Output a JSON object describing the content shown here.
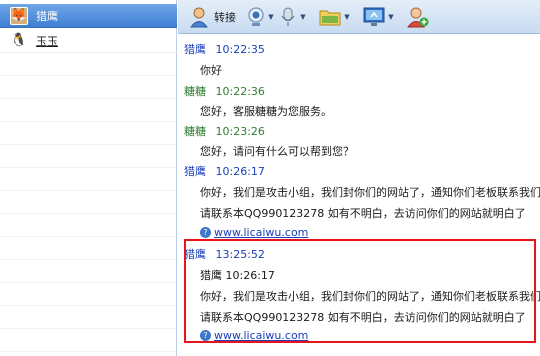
{
  "contacts": [
    {
      "name": "猎鹰",
      "selected": true,
      "avatar_icon": "fox-avatar-icon"
    },
    {
      "name": "玉玉",
      "selected": false,
      "avatar_icon": "penguin-icon"
    }
  ],
  "toolbar": {
    "transfer_label": "转接",
    "icons": [
      "person-transfer-icon",
      "webcam-icon",
      "microphone-icon",
      "folder-icon",
      "screen-share-icon",
      "add-contact-icon"
    ]
  },
  "messages": [
    {
      "sender": "猎鹰",
      "time": "10:22:35",
      "color": "blue",
      "lines": [
        "你好"
      ]
    },
    {
      "sender": "糖糖",
      "time": "10:22:36",
      "color": "green",
      "lines": [
        "您好，客服糖糖为您服务。"
      ]
    },
    {
      "sender": "糖糖",
      "time": "10:23:26",
      "color": "green",
      "lines": [
        "您好，请问有什么可以帮到您？"
      ]
    },
    {
      "sender": "猎鹰",
      "time": "10:26:17",
      "color": "blue",
      "lines": [
        "你好，我们是攻击小组，我们封你们的网站了，通知你们老板联系我们",
        "请联系本QQ990123278 如有不明白，去访问你们的网站就明白了"
      ],
      "link": "www.licaiwu.com"
    },
    {
      "sender": "猎鹰",
      "time": "13:25:52",
      "color": "blue",
      "quoted": "猎鹰  10:26:17",
      "lines": [
        "你好，我们是攻击小组，我们封你们的网站了，通知你们老板联系我们",
        "请联系本QQ990123278 如有不明白，去访问你们的网站就明白了"
      ],
      "link": "www.licaiwu.com"
    }
  ],
  "colors": {
    "accent_blue": "#1a3fb9",
    "accent_green": "#2e7d32",
    "highlight": "#e8141c",
    "selected_row": "#3f7fd3"
  }
}
